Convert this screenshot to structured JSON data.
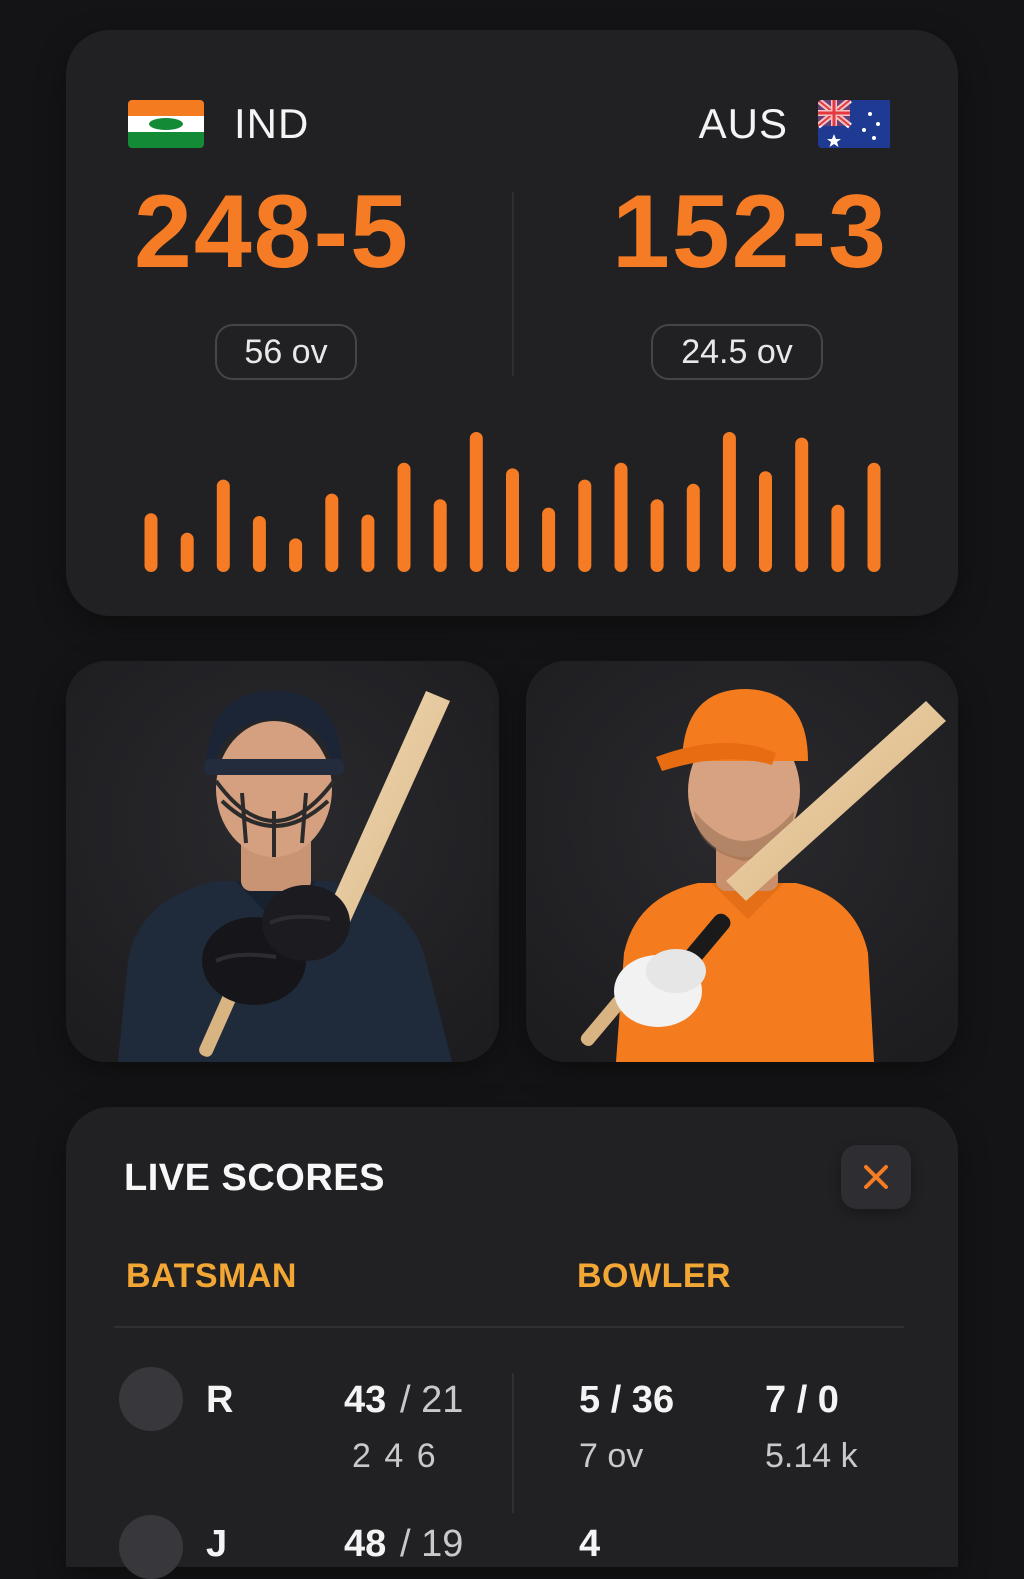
{
  "header": {
    "team_left": {
      "name": "IND",
      "score": "248-5",
      "overs": "56 ov"
    },
    "team_right": {
      "name": "AUS",
      "score": "152-3",
      "overs": "24.5 ov"
    }
  },
  "run_rate_chart": {
    "bar_color": "#f57c24",
    "values": [
      0.42,
      0.28,
      0.66,
      0.4,
      0.24,
      0.56,
      0.41,
      0.78,
      0.52,
      1.0,
      0.74,
      0.46,
      0.66,
      0.78,
      0.52,
      0.63,
      1.0,
      0.72,
      0.96,
      0.48,
      0.78
    ]
  },
  "players": [
    {
      "role": "batsman",
      "name": ""
    },
    {
      "role": "bowler",
      "name": ""
    }
  ],
  "live": {
    "title": "LIVE SCORES",
    "close_label": "×",
    "batsman_head": "BATSMAN",
    "bowler_head": "BOWLER",
    "rows": [
      {
        "player": "R",
        "runs": "43",
        "balls": "/ 21",
        "detail": "2  4  6",
        "bowl_1": "5 / 36",
        "bowl_1_sub": "7 ov",
        "bowl_2": "7 / 0",
        "bowl_2_sub": "5.14 k"
      },
      {
        "player": "J",
        "runs": "48",
        "balls": "/ 19",
        "detail": "",
        "bowl_1": "4",
        "bowl_1_sub": "",
        "bowl_2": "",
        "bowl_2_sub": ""
      }
    ]
  },
  "colors": {
    "accent": "#f57c24",
    "section_head": "#f2a634",
    "card_bg": "#212124",
    "page_bg": "#141416"
  }
}
